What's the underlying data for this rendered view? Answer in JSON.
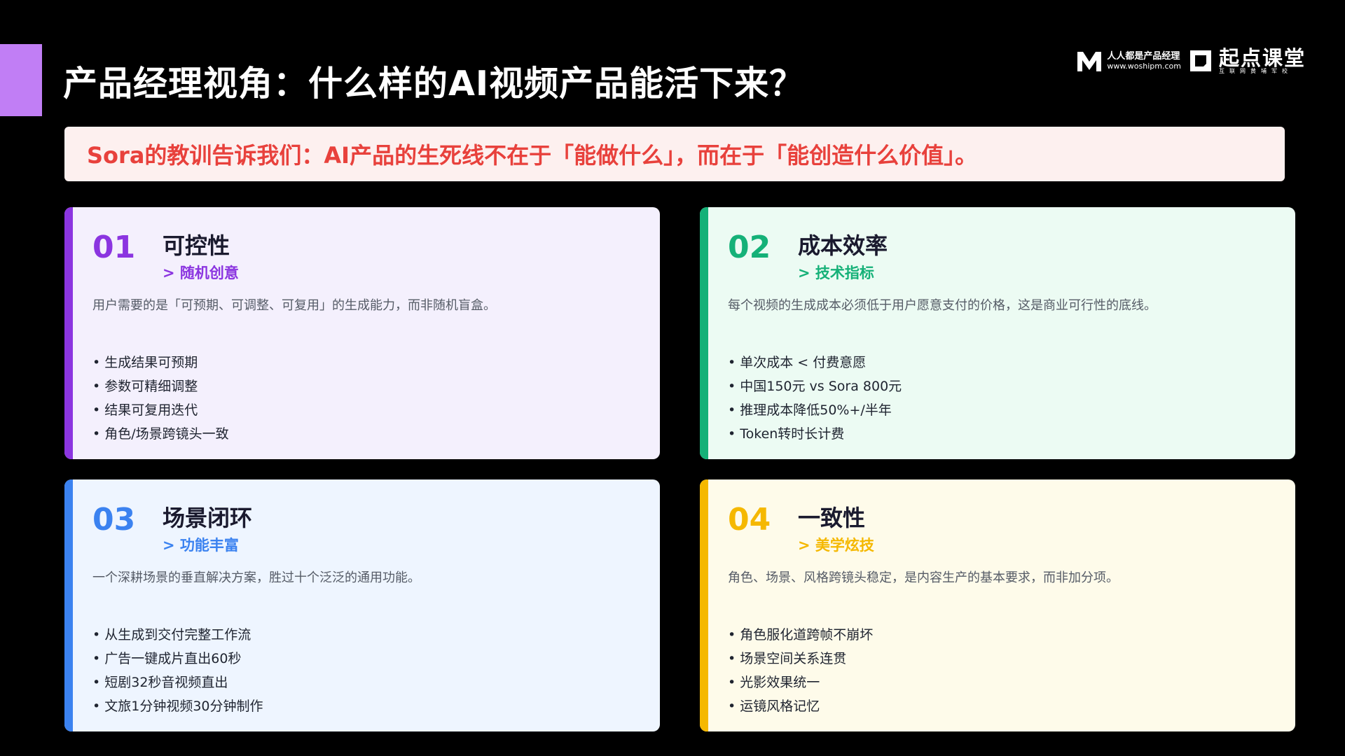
{
  "slide": {
    "title": "产品经理视角：什么样的AI视频产品能活下来？",
    "accent_color": "#c17ef5"
  },
  "logos": {
    "woshipm": {
      "icon": "m-logo-icon",
      "line1": "人人都是产品经理",
      "line2": "www.woshipm.com"
    },
    "qidian": {
      "icon": "q-logo-icon",
      "line1": "起点课堂",
      "line2": "互联网黄埔军校"
    }
  },
  "banner": {
    "text": "Sora的教训告诉我们：AI产品的生死线不在于「能做什么」，而在于「能创造什么价值」。",
    "color": "#e8413c"
  },
  "cards": [
    {
      "number": "01",
      "title": "可控性",
      "subtitle": "> 随机创意",
      "description": "用户需要的是「可预期、可调整、可复用」的生成能力，而非随机盲盒。",
      "bullets": [
        "生成结果可预期",
        "参数可精细调整",
        "结果可复用迭代",
        "角色/场景跨镜头一致"
      ],
      "accent": "#8b35e0"
    },
    {
      "number": "02",
      "title": "成本效率",
      "subtitle": "> 技术指标",
      "description": "每个视频的生成成本必须低于用户愿意支付的价格，这是商业可行性的底线。",
      "bullets": [
        "单次成本 < 付费意愿",
        "中国150元 vs Sora 800元",
        "推理成本降低50%+/半年",
        "Token转时长计费"
      ],
      "accent": "#15b178"
    },
    {
      "number": "03",
      "title": "场景闭环",
      "subtitle": "> 功能丰富",
      "description": "一个深耕场景的垂直解决方案，胜过十个泛泛的通用功能。",
      "bullets": [
        "从生成到交付完整工作流",
        "广告一键成片直出60秒",
        "短剧32秒音视频直出",
        "文旅1分钟视频30分钟制作"
      ],
      "accent": "#3b82f0"
    },
    {
      "number": "04",
      "title": "一致性",
      "subtitle": "> 美学炫技",
      "description": "角色、场景、风格跨镜头稳定，是内容生产的基本要求，而非加分项。",
      "bullets": [
        "角色服化道跨帧不崩坏",
        "场景空间关系连贯",
        "光影效果统一",
        "运镜风格记忆"
      ],
      "accent": "#f5b800"
    }
  ]
}
